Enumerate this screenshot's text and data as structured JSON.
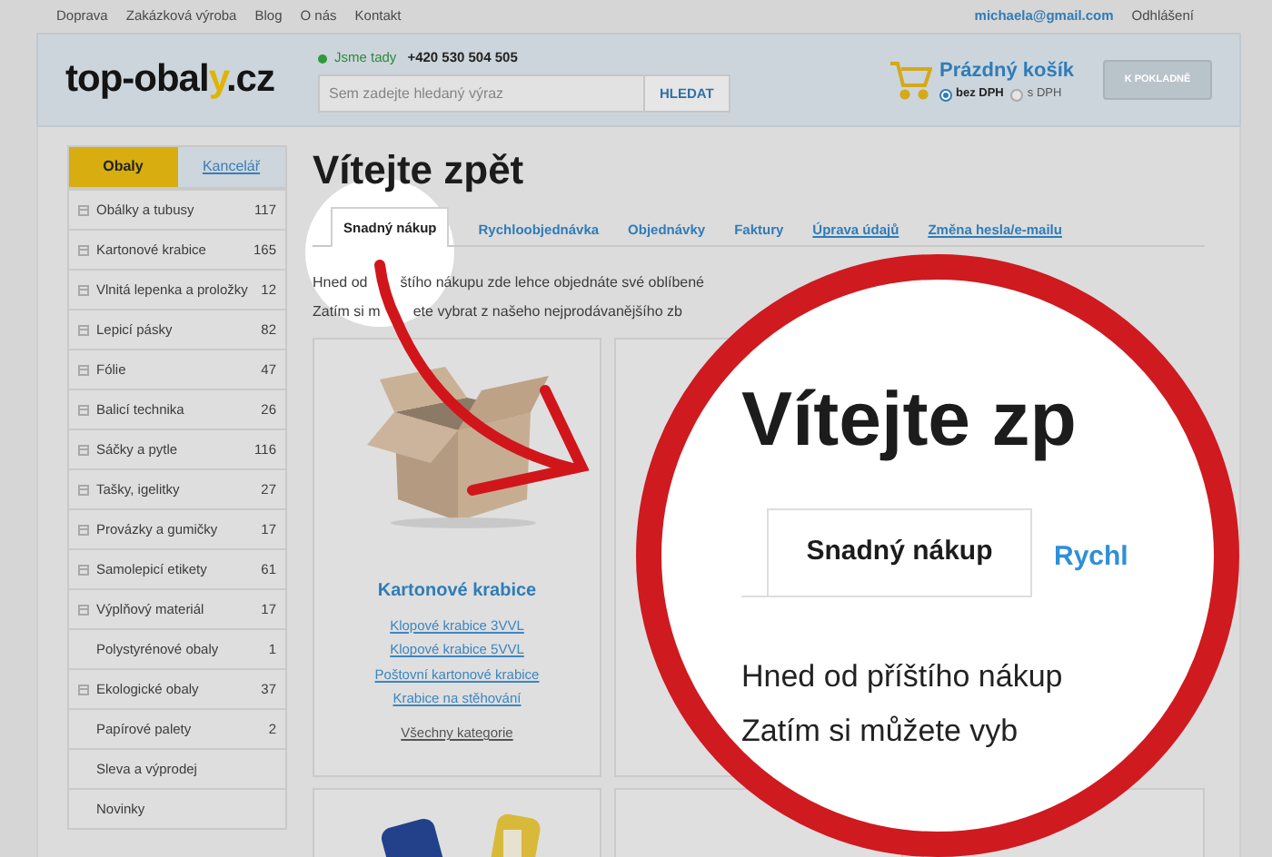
{
  "top_links": [
    "Doprava",
    "Zakázková výroba",
    "Blog",
    "O nás",
    "Kontakt"
  ],
  "account": {
    "email": "michaela@gmail.com",
    "logout": "Odhlášení"
  },
  "header": {
    "logo": {
      "main": "top-obal",
      "accent": "y",
      "suffix": ".cz"
    },
    "status": {
      "label": "Jsme tady",
      "online": true,
      "phone": "+420 530 504 505"
    },
    "search": {
      "placeholder": "Sem zadejte hledaný výraz",
      "button": "HLEDAT"
    },
    "cart": {
      "title": "Prázdný košík",
      "vat_options": [
        {
          "label": "bez DPH",
          "selected": true
        },
        {
          "label": "s DPH",
          "selected": false
        }
      ],
      "checkout": {
        "label": "K POKLADNĚ",
        "disabled": true
      }
    }
  },
  "sidebar": {
    "tabs": [
      {
        "label": "Obaly",
        "selected": true
      },
      {
        "label": "Kancelář",
        "selected": false
      }
    ],
    "items": [
      {
        "label": "Obálky a tubusy",
        "count": "117",
        "expandable": true
      },
      {
        "label": "Kartonové krabice",
        "count": "165",
        "expandable": true
      },
      {
        "label": "Vlnitá lepenka a proložky",
        "count": "12",
        "expandable": true
      },
      {
        "label": "Lepicí pásky",
        "count": "82",
        "expandable": true
      },
      {
        "label": "Fólie",
        "count": "47",
        "expandable": true
      },
      {
        "label": "Balicí technika",
        "count": "26",
        "expandable": true
      },
      {
        "label": "Sáčky a pytle",
        "count": "116",
        "expandable": true
      },
      {
        "label": "Tašky, igelitky",
        "count": "27",
        "expandable": true
      },
      {
        "label": "Provázky a gumičky",
        "count": "17",
        "expandable": true
      },
      {
        "label": "Samolepicí etikety",
        "count": "61",
        "expandable": true
      },
      {
        "label": "Výplňový materiál",
        "count": "17",
        "expandable": true
      },
      {
        "label": "Polystyrénové obaly",
        "count": "1",
        "expandable": false
      },
      {
        "label": "Ekologické obaly",
        "count": "37",
        "expandable": true
      },
      {
        "label": "Papírové palety",
        "count": "2",
        "expandable": false
      },
      {
        "label": "Sleva a výprodej",
        "expandable": false
      },
      {
        "label": "Novinky",
        "expandable": false
      }
    ]
  },
  "main": {
    "title": "Vítejte zpět",
    "tabs": [
      {
        "label": "Snadný nákup",
        "selected": true
      },
      {
        "label": "Rychloobjednávka",
        "selected": false
      },
      {
        "label": "Objednávky",
        "selected": false
      },
      {
        "label": "Faktury",
        "selected": false
      },
      {
        "label": "Úprava údajů",
        "selected": false
      },
      {
        "label": "Změna hesla/e-mailu",
        "selected": false
      }
    ],
    "intro": [
      {
        "before": "Hned od",
        "after": "štího nákupu zde lehce objednáte své oblíbené"
      },
      {
        "before": "Zatím si m",
        "after": "ete vybrat z našeho nejprodávanějšího zb"
      }
    ],
    "cards": [
      {
        "title": "Kartonové krabice",
        "links": [
          "Klopové krabice 3VVL",
          "Klopové krabice 5VVL",
          "Poštovní kartonové krabice",
          "Krabice na stěhování"
        ],
        "all": "Všechny kategorie"
      }
    ]
  },
  "magnifier": {
    "title": "Vítejte zp",
    "tab": "Snadný nákup",
    "next_tab": "Rychl",
    "lines": [
      "Hned od příštího nákup",
      "Zatím si můžete vyb"
    ]
  }
}
